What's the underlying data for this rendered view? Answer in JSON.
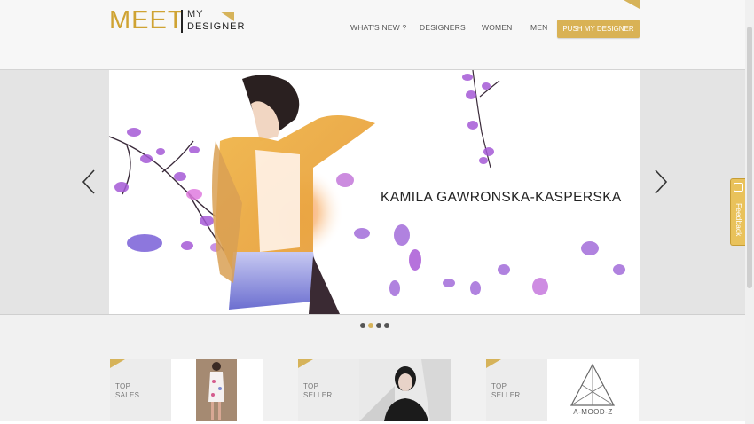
{
  "header": {
    "logo": {
      "meet": "MEET",
      "my": "MY",
      "designer": "DESIGNER"
    },
    "nav": [
      {
        "label": "WHAT'S NEW ?"
      },
      {
        "label": "DESIGNERS"
      },
      {
        "label": "WOMEN"
      },
      {
        "label": "MEN"
      }
    ],
    "cta": "PUSH MY DESIGNER"
  },
  "hero": {
    "title": "KAMILA GAWRONSKA-KASPERSKA",
    "slide_count": 4,
    "active_slide": 2
  },
  "feedback": {
    "label": "Feedback"
  },
  "cards": [
    {
      "line1": "TOP",
      "line2": "SALES"
    },
    {
      "line1": "TOP",
      "line2": "SELLER"
    },
    {
      "line1": "TOP",
      "line2": "SELLER",
      "brand": "A-MOOD-Z"
    }
  ],
  "colors": {
    "accent": "#d6b35a",
    "cta": "#d9b255"
  }
}
